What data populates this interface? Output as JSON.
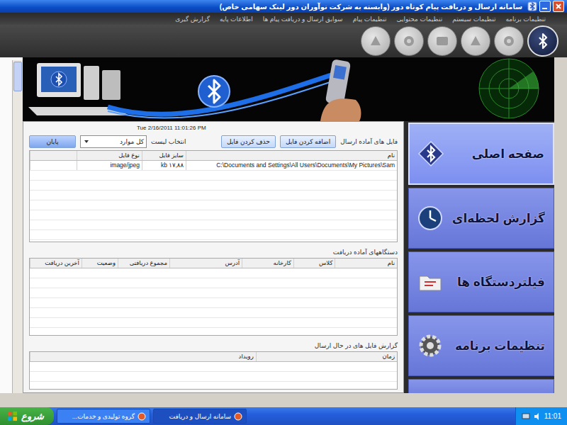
{
  "window": {
    "title": "سامانه ارسال و دریافت پیام کوتاه دور (وابسته به شرکت نوآوران دور لینک سهامی خاص)"
  },
  "menu": [
    "تنظیمات برنامه",
    "تنظیمات سیستم",
    "تنظیمات محتوایی",
    "تنظیمات پیام",
    "سوابق ارسال و دریافت پیام ها",
    "اطلاعات پایه",
    "گزارش گیری"
  ],
  "toolbar": [
    {
      "selected": true
    },
    {
      "selected": false
    },
    {
      "selected": false
    },
    {
      "selected": false
    },
    {
      "selected": false
    },
    {
      "selected": false
    }
  ],
  "timestamp": "Tue 2/16/2011 11:01:26 PM",
  "files": {
    "label": "فایل های آماده ارسال",
    "add_button": "اضافه کردن فایل",
    "remove_button": "حذف کردن فایل",
    "list_label": "انتخاب لیست",
    "list_value": "کل موارد",
    "end_button": "پایان",
    "columns": [
      "نام",
      "سایز فایل",
      "نوع فایل"
    ],
    "rows": [
      [
        "C:\\Documents and Settings\\All Users\\Documents\\My Pictures\\Sam",
        "kb ۱۷,۸۸",
        "image/jpeg"
      ]
    ]
  },
  "devices": {
    "label": "دستگاههای آماده دریافت",
    "columns": [
      "نام",
      "کلاس",
      "کارخانه",
      "آدرس",
      "مجموع دریافتی",
      "وضعیت",
      "آخرین دریافت"
    ],
    "rows": []
  },
  "report": {
    "label": "گزارش فایل های در حال ارسال",
    "columns": [
      "زمان",
      "رویداد"
    ],
    "rows": []
  },
  "sidebar": {
    "items": [
      {
        "label": "صفحه اصلی",
        "selected": true
      },
      {
        "label": "گزارش لحظه‌ای",
        "selected": false
      },
      {
        "label": "فیلتردستگاه ها",
        "selected": false
      },
      {
        "label": "تنظیمات برنامه",
        "selected": false
      }
    ]
  },
  "taskbar": {
    "start": "شروع",
    "tasks": [
      {
        "label": "گروه تولیدی و خدمات...",
        "selected": false
      },
      {
        "label": "سامانه ارسال و دریافت",
        "selected": true
      }
    ],
    "clock": "11:01"
  }
}
